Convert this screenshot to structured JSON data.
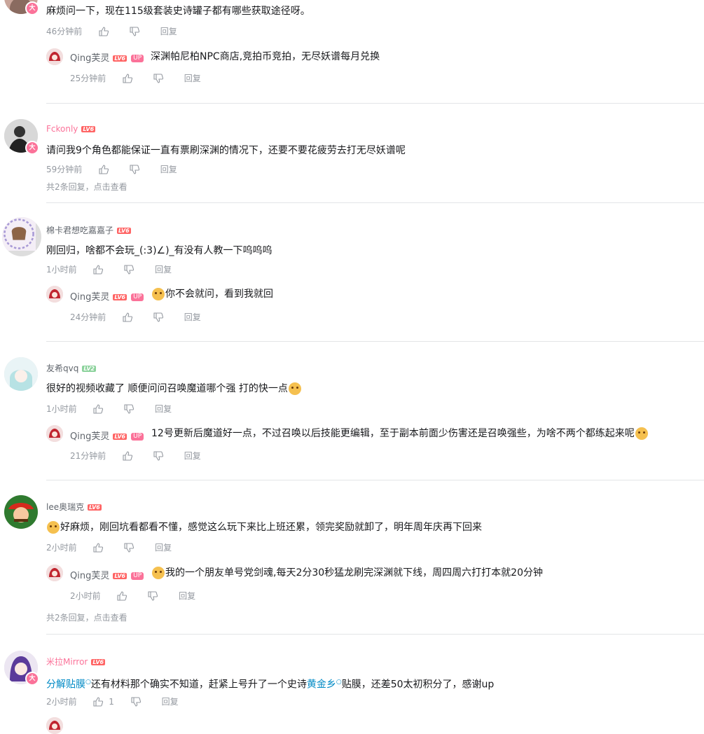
{
  "meta": {
    "like_icon": "thumb-up-icon",
    "dislike_icon": "thumb-down-icon",
    "reply_label": "回复",
    "accent": "#fb7299",
    "link_color": "#008ac5"
  },
  "threads": [
    {
      "content": "麻烦问一下，现在115级套装史诗罐子都有哪些获取途径呀。",
      "time": "46分钟前",
      "replies": [
        {
          "name": "Qing芙灵",
          "level": "LV6",
          "up": "UP",
          "text": "深渊帕尼柏NPC商店,竞拍币竞拍，无尽妖谱每月兑换",
          "time": "25分钟前"
        }
      ]
    },
    {
      "name": "Fckonly",
      "level": "LV6",
      "content": "请问我9个角色都能保证一直有票刷深渊的情况下，还要不要花疲劳去打无尽妖谱呢",
      "time": "59分钟前",
      "more": "共2条回复，点击查看"
    },
    {
      "name": "棉卡君想吃嘉嘉子",
      "level": "LV6",
      "content": "刚回归，啥都不会玩_(:3)∠)_有没有人教一下呜呜呜",
      "time": "1小时前",
      "replies": [
        {
          "name": "Qing芙灵",
          "level": "LV6",
          "up": "UP",
          "text": "你不会就问，看到我就回",
          "time": "24分钟前"
        }
      ]
    },
    {
      "name": "友希qvq",
      "level": "LV2",
      "content": "很好的视频收藏了 顺便问问召唤魔道哪个强 打的快一点",
      "time": "1小时前",
      "replies": [
        {
          "name": "Qing芙灵",
          "level": "LV6",
          "up": "UP",
          "text": "12号更新后魔道好一点，不过召唤以后技能更编辑，至于副本前面少伤害还是召唤强些，为啥不两个都练起来呢",
          "time": "21分钟前"
        }
      ]
    },
    {
      "name": "lee奥瑞克",
      "level": "LV6",
      "content": "好麻烦，刚回坑看都看不懂，感觉这么玩下来比上班还累，领完奖励就卸了，明年周年庆再下回来",
      "time": "2小时前",
      "replies": [
        {
          "name": "Qing芙灵",
          "level": "LV6",
          "up": "UP",
          "text": "我的一个朋友单号党剑魂,每天2分30秒猛龙刷完深渊就下线，周四周六打打本就20分钟",
          "time": "2小时前"
        }
      ],
      "more": "共2条回复，点击查看"
    },
    {
      "name": "米拉Mirror",
      "level": "LV6",
      "content_link1": "分解贴膜",
      "content_mid": "还有材料那个确实不知道，赶紧上号升了一个史诗",
      "content_link2": "黄金乡",
      "content_end": "贴膜，还差50太初积分了，感谢up",
      "time": "2小时前",
      "likes": "1"
    }
  ]
}
